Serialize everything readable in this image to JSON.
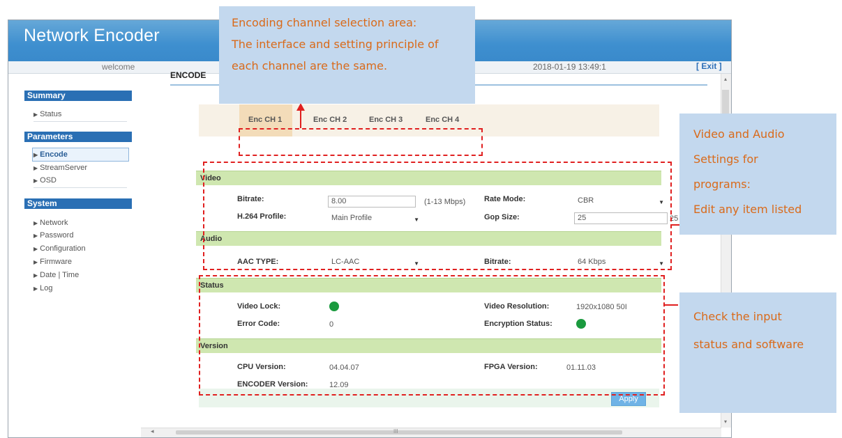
{
  "app": {
    "title": "Network Encoder",
    "welcome": "welcome",
    "datetime": "2018-01-19 13:49:1",
    "exit_label": "[ Exit ]"
  },
  "sidebar": {
    "summary": {
      "title": "Summary",
      "items": [
        "Status"
      ]
    },
    "parameters": {
      "title": "Parameters",
      "items": [
        "Encode",
        "StreamServer",
        "OSD"
      ],
      "selected": "Encode"
    },
    "system": {
      "title": "System",
      "items": [
        "Network",
        "Password",
        "Configuration",
        "Firmware",
        "Date | Time",
        "Log"
      ]
    }
  },
  "main": {
    "title": "ENCODE"
  },
  "tabs": [
    "Enc CH 1",
    "Enc CH 2",
    "Enc CH 3",
    "Enc CH 4"
  ],
  "video": {
    "title": "Video",
    "bitrate_label": "Bitrate:",
    "bitrate_value": "8.00",
    "bitrate_hint": "(1-13 Mbps)",
    "rate_mode_label": "Rate Mode:",
    "rate_mode_value": "CBR",
    "profile_label": "H.264 Profile:",
    "profile_value": "Main Profile",
    "gop_label": "Gop Size:",
    "gop_value": "25",
    "gop_hint": "25"
  },
  "audio": {
    "title": "Audio",
    "aac_label": "AAC TYPE:",
    "aac_value": "LC-AAC",
    "bitrate_label": "Bitrate:",
    "bitrate_value": "64 Kbps"
  },
  "status": {
    "title": "Status",
    "video_lock_label": "Video Lock:",
    "resolution_label": "Video Resolution:",
    "resolution_value": "1920x1080 50I",
    "error_label": "Error Code:",
    "error_value": "0",
    "encryption_label": "Encryption Status:",
    "status_color": "#1a9a3e"
  },
  "version": {
    "title": "Version",
    "cpu_label": "CPU Version:",
    "cpu_value": "04.04.07",
    "fpga_label": "FPGA Version:",
    "fpga_value": "01.11.03",
    "encoder_label": "ENCODER Version:",
    "encoder_value": "12.09"
  },
  "apply_label": "Apply",
  "scrollbar_h_glyph": "III",
  "annotations": {
    "channel": [
      "Encoding channel selection area:",
      "The interface and setting principle of",
      "each channel are the same."
    ],
    "av": [
      "Video and Audio",
      "Settings for",
      "programs:",
      "Edit any item listed"
    ],
    "status": [
      "Check the input",
      "status and software"
    ]
  }
}
